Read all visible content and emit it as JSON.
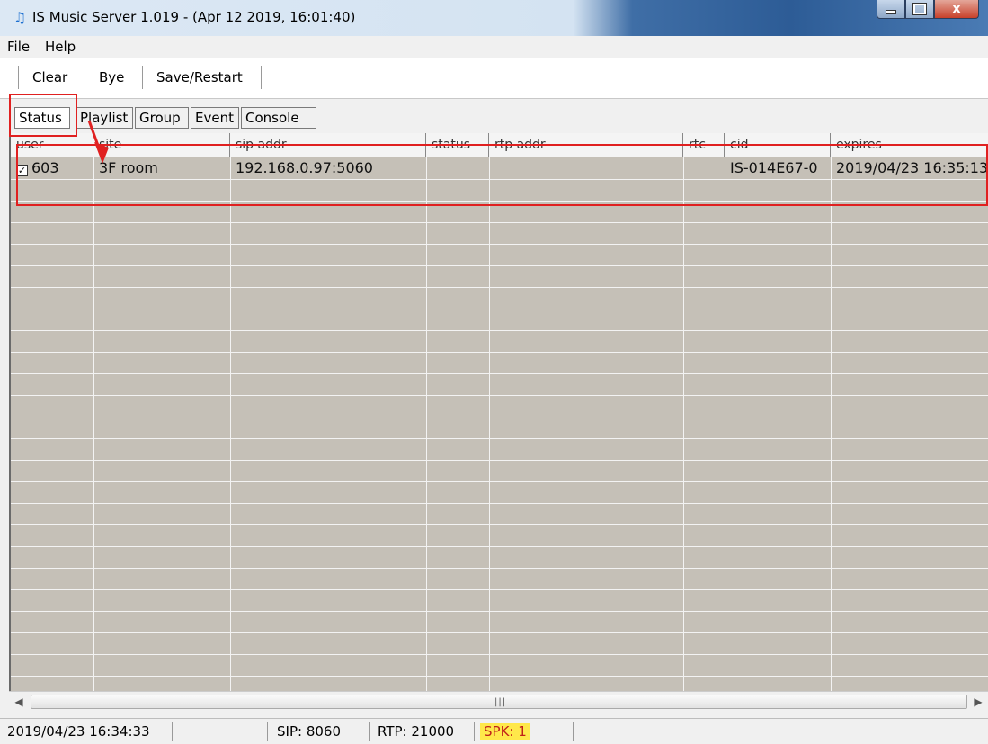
{
  "window": {
    "title": "IS Music Server 1.019 - (Apr 12 2019, 16:01:40)",
    "close_glyph": "x"
  },
  "menu": {
    "items": [
      "File",
      "Help"
    ]
  },
  "toolbar": {
    "buttons": [
      "Clear",
      "Bye",
      "Save/Restart"
    ]
  },
  "tabs": {
    "items": [
      "Status",
      "Playlist",
      "Group",
      "Event",
      "Console"
    ],
    "active": "Status"
  },
  "table": {
    "columns": [
      "user",
      "site",
      "sip addr",
      "status",
      "rtp addr",
      "rtc",
      "cid",
      "expires"
    ],
    "rows": [
      {
        "checked": true,
        "user": "603",
        "site": "3F room",
        "sip_addr": "192.168.0.97:5060",
        "status": "",
        "rtp_addr": "",
        "rtc": "",
        "cid": "IS-014E67-0",
        "expires": "2019/04/23 16:35:13"
      }
    ]
  },
  "statusbar": {
    "time": "2019/04/23 16:34:33",
    "sip": "SIP: 8060",
    "rtp": "RTP: 21000",
    "spk": "SPK: 1"
  },
  "colors": {
    "annotation": "#e02020",
    "table_bg": "#c5c0b7",
    "spk_highlight": "#ffe84a"
  }
}
